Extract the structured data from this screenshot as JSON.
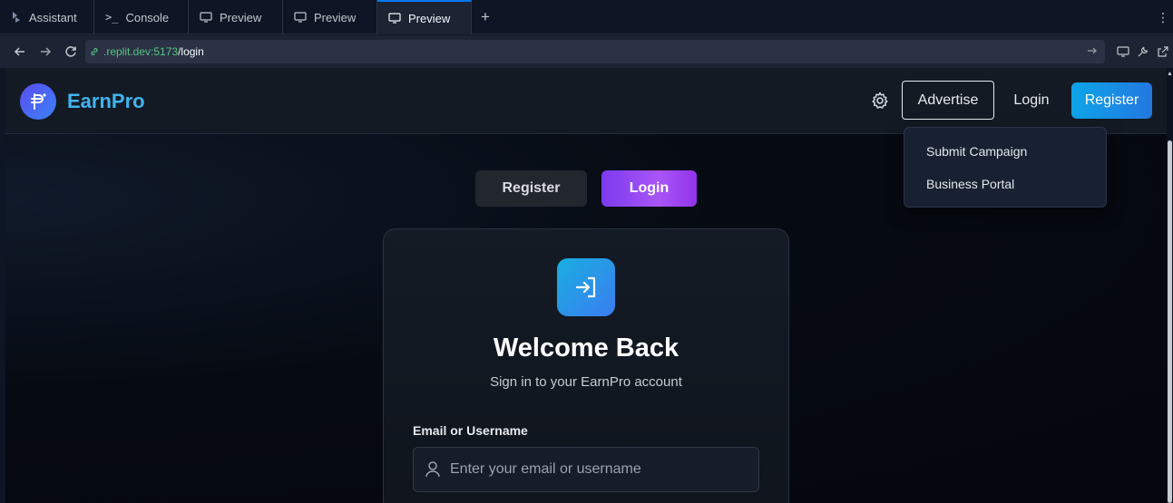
{
  "replit": {
    "tabs": [
      {
        "label": "Assistant",
        "icon": "assistant-icon",
        "active": false
      },
      {
        "label": "Console",
        "icon": "terminal-icon",
        "active": false
      },
      {
        "label": "Preview",
        "icon": "monitor-icon",
        "active": false
      },
      {
        "label": "Preview",
        "icon": "monitor-icon",
        "active": false
      },
      {
        "label": "Preview",
        "icon": "monitor-icon",
        "active": true
      }
    ],
    "add_tab": "+",
    "more": "⋮",
    "url": {
      "host": ".replit.dev:5173",
      "path": "/login"
    },
    "accent": "#0079f2"
  },
  "app": {
    "brand": "EarnPro",
    "header": {
      "advertise": "Advertise",
      "login": "Login",
      "register": "Register"
    },
    "dropdown": [
      "Submit Campaign",
      "Business Portal"
    ],
    "auth_tabs": {
      "register": "Register",
      "login": "Login",
      "active": "login"
    },
    "card": {
      "title": "Welcome Back",
      "subtitle": "Sign in to your EarnPro account",
      "email_label": "Email or Username",
      "email_placeholder": "Enter your email or username",
      "email_value": ""
    },
    "colors": {
      "brand": "#3fb5f0",
      "register_gradient": [
        "#0ea5e9",
        "#2377e0"
      ],
      "login_gradient": [
        "#7c3aed",
        "#a855f7"
      ],
      "icon_gradient": [
        "#1aaee0",
        "#3a7df0"
      ]
    }
  }
}
